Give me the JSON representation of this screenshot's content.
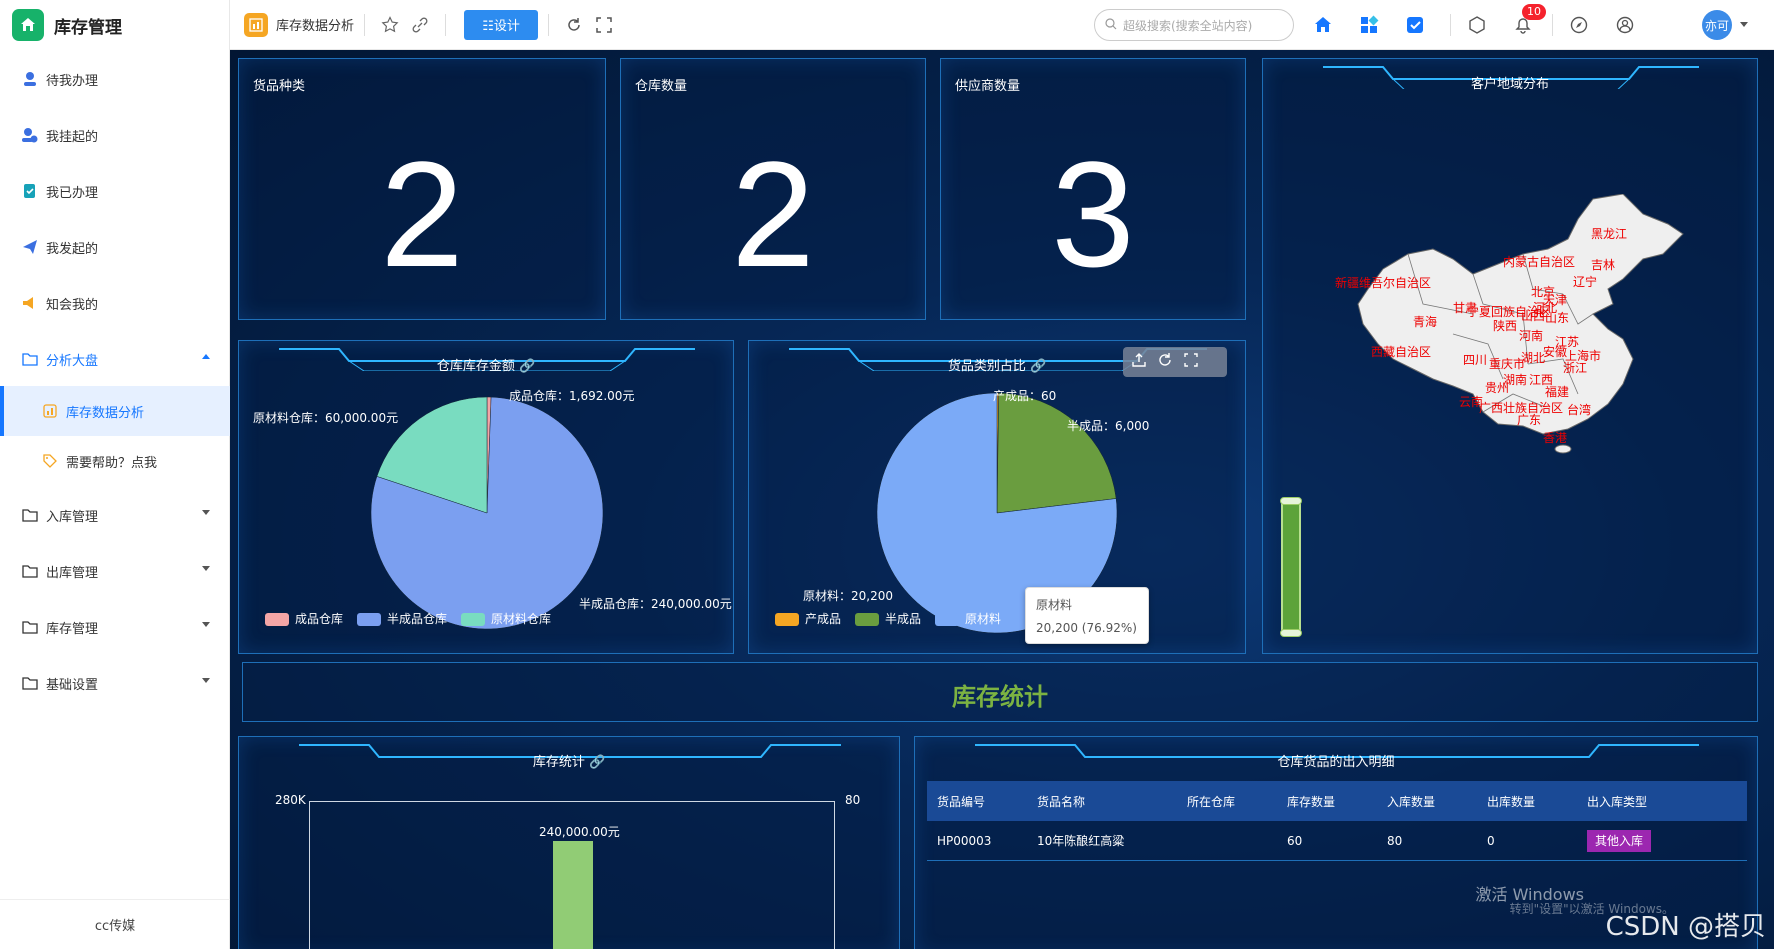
{
  "sidebar": {
    "title": "库存管理",
    "items": [
      {
        "label": "待我办理",
        "icon": "user-task-icon"
      },
      {
        "label": "我挂起的",
        "icon": "user-pause-icon"
      },
      {
        "label": "我已办理",
        "icon": "done-icon"
      },
      {
        "label": "我发起的",
        "icon": "send-icon"
      },
      {
        "label": "知会我的",
        "icon": "speaker-icon"
      },
      {
        "label": "分析大盘",
        "icon": "folder-icon"
      },
      {
        "label": "库存数据分析",
        "icon": "chart-icon"
      },
      {
        "label": "需要帮助？点我",
        "icon": "tag-icon"
      },
      {
        "label": "入库管理",
        "icon": "folder-icon"
      },
      {
        "label": "出库管理",
        "icon": "folder-icon"
      },
      {
        "label": "库存管理",
        "icon": "folder-icon"
      },
      {
        "label": "基础设置",
        "icon": "folder-icon"
      }
    ],
    "footer": "cc传媒"
  },
  "topbar": {
    "page_title": "库存数据分析",
    "design_label": "☷设计",
    "search_placeholder": "超级搜索(搜索全站内容)",
    "notification_count": "10",
    "avatar_text": "亦可"
  },
  "stats": [
    {
      "title": "货品种类",
      "value": "2"
    },
    {
      "title": "仓库数量",
      "value": "2"
    },
    {
      "title": "供应商数量",
      "value": "3"
    }
  ],
  "map_panel": {
    "title": "客户地域分布",
    "labels": [
      "黑龙江",
      "吉林",
      "内蒙古自治区",
      "辽宁",
      "新疆维吾尔自治区",
      "北京",
      "天津",
      "宁夏回族自治区",
      "山西",
      "河北",
      "青海",
      "甘肃",
      "山东",
      "陕西",
      "河南",
      "江苏",
      "安徽",
      "上海市",
      "西藏自治区",
      "四川",
      "重庆市",
      "湖北",
      "浙江",
      "湖南",
      "江西",
      "贵州",
      "福建",
      "云南",
      "广西壮族自治区",
      "台湾",
      "广东",
      "香港"
    ]
  },
  "warehouse_chart": {
    "title": "仓库库存金额",
    "labels": [
      "成品仓库：1,692.00元",
      "原材料仓库：60,000.00元",
      "半成品仓库：240,000.00元"
    ],
    "legend": [
      "成品仓库",
      "半成品仓库",
      "原材料仓库"
    ]
  },
  "category_chart": {
    "title": "货品类别占比",
    "labels": [
      "产成品：60",
      "半成品：6,000",
      "原材料：20,200"
    ],
    "legend": [
      "产成品",
      "半成品",
      "原材料"
    ],
    "tooltip_name": "原材料",
    "tooltip_value": "20,200 (76.92%)"
  },
  "banner": {
    "title": "库存统计"
  },
  "stock_chart": {
    "title": "库存统计",
    "y_left_top": "280K",
    "y_right_top": "80",
    "bar_label": "240,000.00元"
  },
  "detail_table": {
    "title": "仓库货品的出入明细",
    "headers": [
      "货品编号",
      "货品名称",
      "所在仓库",
      "库存数量",
      "入库数量",
      "出库数量",
      "出入库类型"
    ],
    "row": [
      "HP00003",
      "10年陈酿红高粱",
      "",
      "60",
      "80",
      "0",
      "其他入库"
    ]
  },
  "overlay": {
    "activate": "激活 Windows",
    "activate_sub": "转到\"设置\"以激活 Windows。",
    "csdn": "CSDN @搭贝"
  },
  "chart_data": [
    {
      "type": "pie",
      "title": "仓库库存金额",
      "categories": [
        "成品仓库",
        "半成品仓库",
        "原材料仓库"
      ],
      "values": [
        1692,
        240000,
        60000
      ],
      "colors": [
        "#f4a6a6",
        "#7b9ff0",
        "#79dcc0"
      ]
    },
    {
      "type": "pie",
      "title": "货品类别占比",
      "categories": [
        "产成品",
        "半成品",
        "原材料"
      ],
      "values": [
        60,
        6000,
        20200
      ],
      "colors": [
        "#f5a623",
        "#6a9d3f",
        "#7baaf7"
      ]
    }
  ]
}
